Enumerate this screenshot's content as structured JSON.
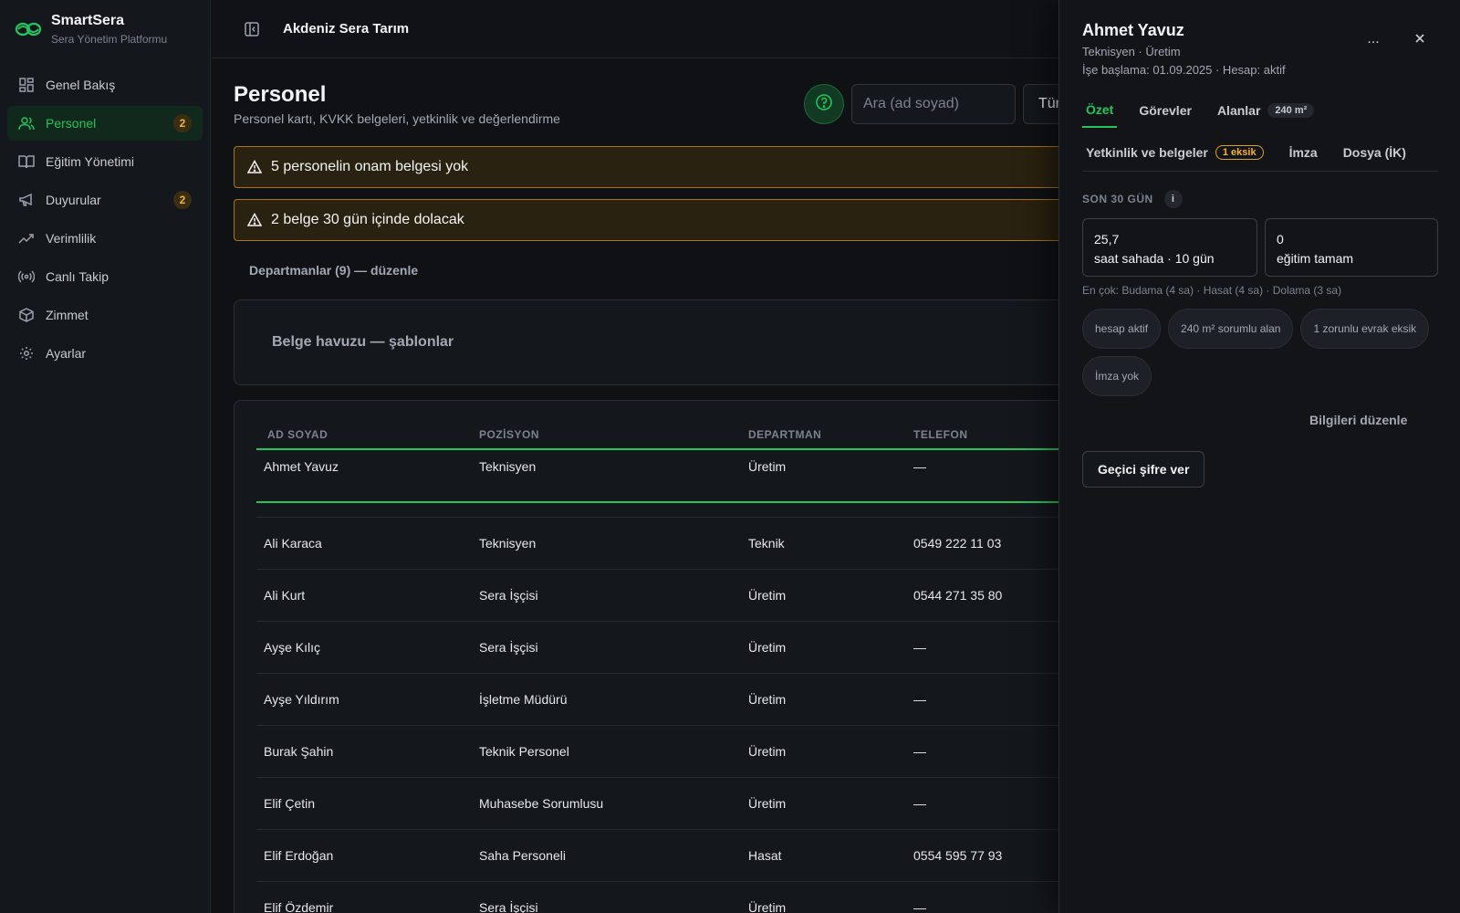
{
  "brand": {
    "name": "SmartSera",
    "subtitle": "Sera Yönetim Platformu"
  },
  "sidebar": {
    "items": [
      {
        "label": "Genel Bakış",
        "icon": "dashboard-icon"
      },
      {
        "label": "Personel",
        "icon": "users-icon",
        "badge": "2",
        "active": true
      },
      {
        "label": "Eğitim Yönetimi",
        "icon": "book-icon"
      },
      {
        "label": "Duyurular",
        "icon": "megaphone-icon",
        "badge": "2"
      },
      {
        "label": "Verimlilik",
        "icon": "trend-icon"
      },
      {
        "label": "Canlı Takip",
        "icon": "broadcast-icon"
      },
      {
        "label": "Zimmet",
        "icon": "package-icon"
      },
      {
        "label": "Ayarlar",
        "icon": "gear-icon"
      }
    ]
  },
  "header": {
    "org": "Akdeniz Sera Tarım"
  },
  "page": {
    "title": "Personel",
    "subtitle": "Personel kartı, KVKK belgeleri, yetkinlik ve değerlendirme",
    "search_placeholder": "Ara (ad soyad)",
    "type_select": "Tür"
  },
  "alerts": [
    "5 personelin onam belgesi yok",
    "2 belge 30 gün içinde dolacak"
  ],
  "departments_link": "Departmanlar (9) — düzenle",
  "pool_card": "Belge havuzu — şablonlar",
  "table": {
    "headers": [
      "AD SOYAD",
      "POZİSYON",
      "DEPARTMAN",
      "TELEFON"
    ],
    "rows": [
      [
        "Ahmet Yavuz",
        "Teknisyen",
        "Üretim",
        "—"
      ],
      [
        "Ali Karaca",
        "Teknisyen",
        "Teknik",
        "0549 222 11 03"
      ],
      [
        "Ali Kurt",
        "Sera İşçisi",
        "Üretim",
        "0544 271 35 80"
      ],
      [
        "Ayşe Kılıç",
        "Sera İşçisi",
        "Üretim",
        "—"
      ],
      [
        "Ayşe Yıldırım",
        "İşletme Müdürü",
        "Üretim",
        "—"
      ],
      [
        "Burak Şahin",
        "Teknik Personel",
        "Üretim",
        "—"
      ],
      [
        "Elif Çetin",
        "Muhasebe Sorumlusu",
        "Üretim",
        "—"
      ],
      [
        "Elif Erdoğan",
        "Saha Personeli",
        "Hasat",
        "0554 595 77 93"
      ],
      [
        "Elif Özdemir",
        "Sera İşçisi",
        "Üretim",
        "—"
      ]
    ]
  },
  "drawer": {
    "name": "Ahmet Yavuz",
    "role": "Teknisyen · Üretim",
    "meta": "İşe başlama: 01.09.2025 · Hesap: aktif",
    "more": "...",
    "tabs1": [
      {
        "label": "Özet",
        "active": true
      },
      {
        "label": "Görevler"
      },
      {
        "label": "Alanlar",
        "pill": "240 m²"
      }
    ],
    "tabs2": [
      {
        "label": "Yetkinlik ve belgeler",
        "pill": "1 eksik"
      },
      {
        "label": "İmza"
      },
      {
        "label": "Dosya (İK)"
      }
    ],
    "section_label": "SON 30 GÜN",
    "info": "i",
    "stats": [
      {
        "value": "25,7",
        "label": "saat sahada · 10 gün"
      },
      {
        "value": "0",
        "label": "eğitim tamam"
      }
    ],
    "most": "En çok: Budama (4 sa) · Hasat (4 sa) · Dolama (3 sa)",
    "chips": [
      "hesap aktif",
      "240 m² sorumlu alan",
      "1 zorunlu evrak eksik",
      "İmza yok"
    ],
    "edit_link": "Bilgileri düzenle",
    "temp_password_button": "Geçici şifre ver"
  },
  "colors": {
    "accent": "#22c55e",
    "warning": "#f5b431",
    "background": "#0f1115"
  }
}
